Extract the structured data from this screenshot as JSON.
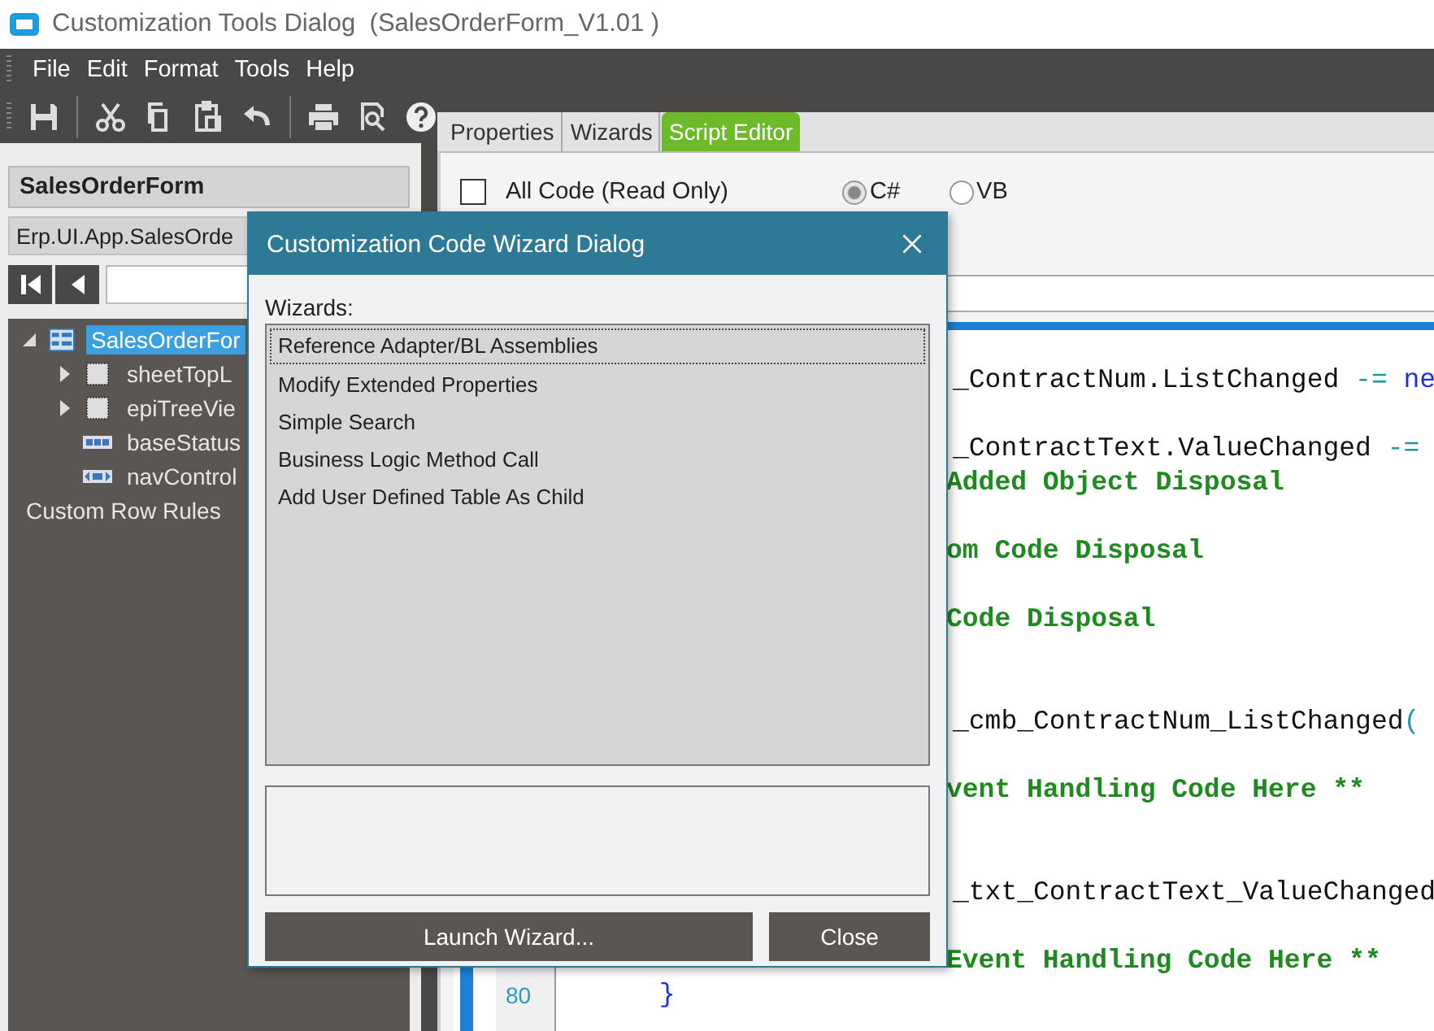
{
  "window": {
    "title": "Customization Tools Dialog  (SalesOrderForm_V1.01 )"
  },
  "menu": [
    "File",
    "Edit",
    "Format",
    "Tools",
    "Help"
  ],
  "left_panel": {
    "form_name": "SalesOrderForm",
    "class_field": "Erp.UI.App.SalesOrde",
    "tree": [
      {
        "label": "SalesOrderFor",
        "kind": "form",
        "selected": true,
        "expanded": true,
        "children": [
          {
            "label": "sheetTopL",
            "kind": "sheet",
            "selected": false,
            "expanded": false
          },
          {
            "label": "epiTreeVie",
            "kind": "sheet",
            "selected": false,
            "expanded": false
          },
          {
            "label": "baseStatus",
            "kind": "statusbar",
            "selected": false
          },
          {
            "label": "navControl",
            "kind": "navigator",
            "selected": false
          }
        ]
      },
      {
        "label": "Custom Row Rules",
        "kind": "rules",
        "selected": false
      }
    ]
  },
  "tabs": [
    {
      "label": "Properties",
      "selected": false
    },
    {
      "label": "Wizards",
      "selected": false
    },
    {
      "label": "Script Editor",
      "selected": true
    }
  ],
  "script_editor": {
    "read_only": {
      "label": "All Code (Read Only)",
      "checked": false
    },
    "languages": [
      {
        "label": "C#",
        "selected": true
      },
      {
        "label": "VB",
        "selected": false
      }
    ],
    "code_lines": [
      {
        "parts": [
          {
            "kind": "code",
            "text": "_ContractNum.ListChanged "
          },
          {
            "kind": "operator",
            "text": "-= "
          },
          {
            "kind": "keyword",
            "text": "ne"
          }
        ]
      },
      {
        "parts": [
          {
            "kind": "code",
            "text": "_ContractText.ValueChanged "
          },
          {
            "kind": "operator",
            "text": "-="
          }
        ]
      },
      {
        "parts": [
          {
            "kind": "comment",
            "text": "Added Object Disposal"
          }
        ]
      },
      {
        "parts": [
          {
            "kind": "comment",
            "text": "om Code Disposal"
          }
        ]
      },
      {
        "parts": [
          {
            "kind": "comment",
            "text": "Code Disposal"
          }
        ]
      },
      {
        "parts": [
          {
            "kind": "code",
            "text": "_cmb_ContractNum_ListChanged"
          },
          {
            "kind": "operator",
            "text": "("
          }
        ]
      },
      {
        "parts": [
          {
            "kind": "comment",
            "text": "vent Handling Code Here **"
          }
        ]
      },
      {
        "parts": [
          {
            "kind": "code",
            "text": "_txt_ContractText_ValueChanged"
          }
        ]
      },
      {
        "parts": [
          {
            "kind": "comment",
            "text": "Event Handling Code Here **"
          }
        ]
      },
      {
        "number": "80",
        "parts": [
          {
            "kind": "keyword",
            "text": "      }"
          }
        ]
      }
    ]
  },
  "dialog": {
    "title": "Customization Code Wizard Dialog",
    "list_label": "Wizards:",
    "wizards": [
      {
        "label": "Reference Adapter/BL Assemblies",
        "selected": true
      },
      {
        "label": "Modify Extended Properties",
        "selected": false
      },
      {
        "label": "Simple Search",
        "selected": false
      },
      {
        "label": "Business Logic Method Call",
        "selected": false
      },
      {
        "label": "Add User Defined Table As Child",
        "selected": false
      }
    ],
    "buttons": [
      "Launch Wizard...",
      "Close"
    ]
  }
}
